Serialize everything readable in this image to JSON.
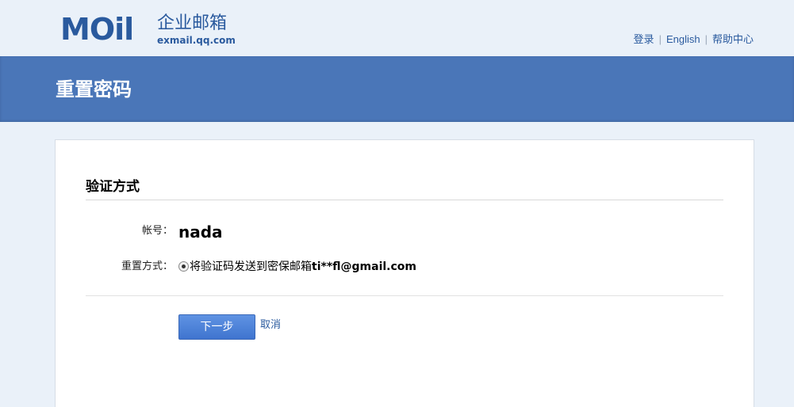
{
  "header": {
    "logo_mail": "MOil",
    "logo_cn": "企业邮箱",
    "logo_domain": "exmail.qq.com",
    "links": {
      "login": "登录",
      "english": "English",
      "help": "帮助中心",
      "separator": "|"
    }
  },
  "band": {
    "title": "重置密码"
  },
  "form": {
    "section_title": "验证方式",
    "account_label": "帐号：",
    "account_value": "nada",
    "method_label": "重置方式：",
    "method_option_text": "将验证码发送到密保邮箱",
    "method_option_email": "ti**fl@gmail.com",
    "next_button": "下一步",
    "cancel_link": "取消"
  },
  "colors": {
    "background": "#eaf1f9",
    "band": "#4a76b8",
    "brand": "#2a5a9e",
    "button": "#4a80d8"
  }
}
